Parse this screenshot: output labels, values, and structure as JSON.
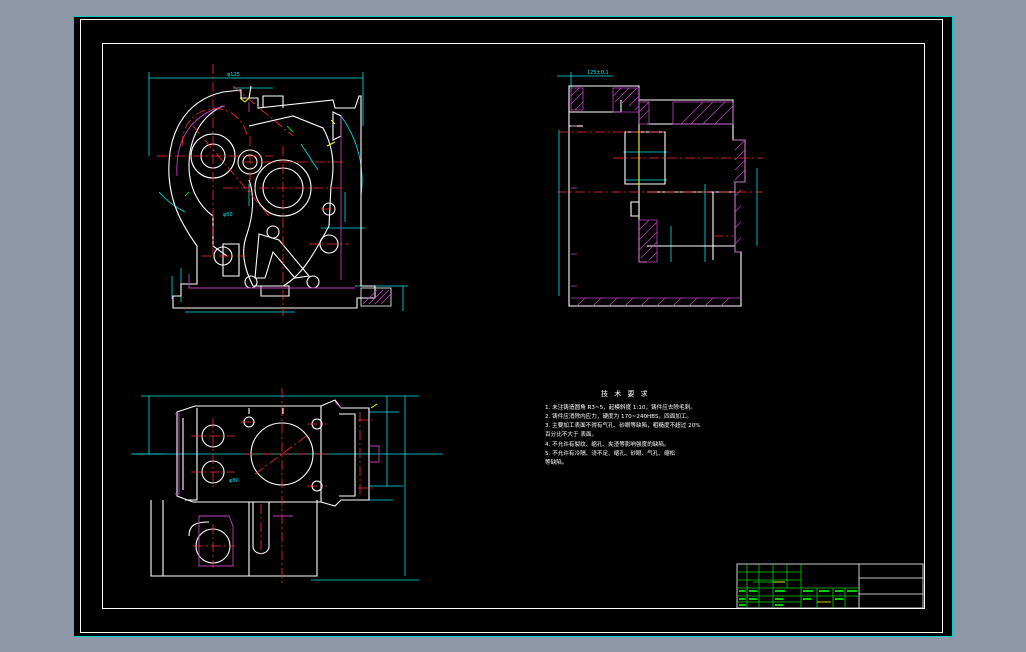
{
  "drawing": {
    "tech_requirements": {
      "title": "技 术 要 求",
      "items": [
        "1. 未注铸造圆角 R3~5，起模斜度 1:10，铸件应去除毛刺。",
        "2. 铸件应消除内应力，硬度为 170~240HBS，四面加工。",
        "3. 主要加工表面不得有气孔、砂眼等缺陷，粗糙度不超过 20%",
        "   百分比不大于 表面。",
        "4. 不允许有裂纹、缩孔、夹渣等影响强度的缺陷。",
        "5. 不允许有冷隔、浇不足、缩孔、砂眼、气孔、缩松",
        "   等缺陷。"
      ]
    },
    "dimensions": {
      "top_width": "φ125",
      "bore_dia_left": "φ60",
      "bore_dia_plan": "φ80",
      "section_top": "125±0.1"
    },
    "title_block": {
      "rows": [
        "",
        "",
        "",
        "",
        ""
      ]
    }
  },
  "colors": {
    "background": "#000000",
    "frame": "#ffffff",
    "outline": "#ffffff",
    "centerline": "#ff2a2a",
    "dimension": "#00e5e5",
    "hatch": "#c040c0",
    "highlight": "#ffff00",
    "green": "#00d000",
    "window_bg": "#8e97a8",
    "viewport_border": "#00cfcf"
  }
}
